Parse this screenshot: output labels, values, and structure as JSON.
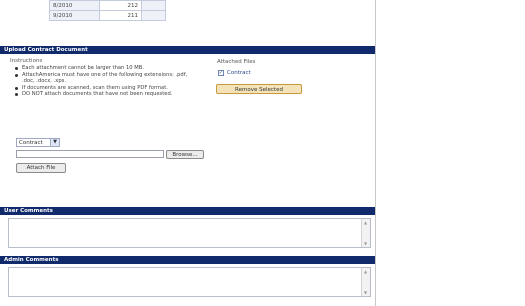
{
  "history_table": {
    "rows": [
      {
        "date": "8/2010",
        "value": "212"
      },
      {
        "date": "9/2010",
        "value": "211"
      }
    ]
  },
  "upload_section": {
    "title": "Upload Contract Document",
    "instructions_title": "Instructions",
    "instructions": [
      "Each attachment cannot be larger than 10 MB.",
      "AttachAmerica must have one of the following extensions: .pdf, .doc, .docx, .xps.",
      "If documents are scanned, scan them using PDF format.",
      "DO NOT attach documents that have not been requested."
    ],
    "attached_files_title": "Attached Files",
    "attached_files": [
      {
        "name": "Contract",
        "checked": true
      }
    ],
    "remove_button": "Remove Selected",
    "document_type": "Contract",
    "browse_button": "Browse...",
    "attach_button": "Attach File"
  },
  "user_comments": {
    "title": "User Comments",
    "value": ""
  },
  "admin_comments": {
    "title": "Admin Comments",
    "value": ""
  }
}
